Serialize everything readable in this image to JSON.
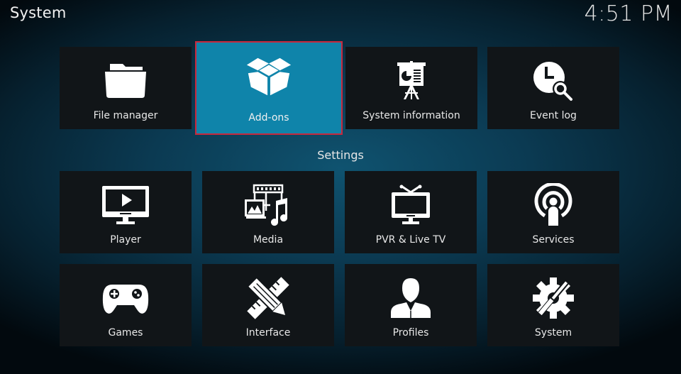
{
  "header": {
    "title": "System",
    "clock": "4:51 PM"
  },
  "top_tiles": [
    {
      "label": "File manager",
      "icon": "folder-icon"
    },
    {
      "label": "Add-ons",
      "icon": "open-box-icon",
      "focused": true
    },
    {
      "label": "System information",
      "icon": "presentation-board-icon"
    },
    {
      "label": "Event log",
      "icon": "clock-search-icon"
    }
  ],
  "settings_section": {
    "heading": "Settings",
    "tiles": [
      {
        "label": "Player",
        "icon": "monitor-play-icon"
      },
      {
        "label": "Media",
        "icon": "media-film-image-music-icon"
      },
      {
        "label": "PVR & Live TV",
        "icon": "tv-antenna-icon"
      },
      {
        "label": "Services",
        "icon": "podcast-broadcast-icon"
      },
      {
        "label": "Games",
        "icon": "gamepad-icon"
      },
      {
        "label": "Interface",
        "icon": "pencil-ruler-icon"
      },
      {
        "label": "Profiles",
        "icon": "user-profile-icon"
      },
      {
        "label": "System",
        "icon": "gear-wrench-icon"
      }
    ]
  },
  "colors": {
    "focus_tile": "#0f84aa",
    "focus_border": "#c8283d",
    "tile_background": "#111518"
  }
}
